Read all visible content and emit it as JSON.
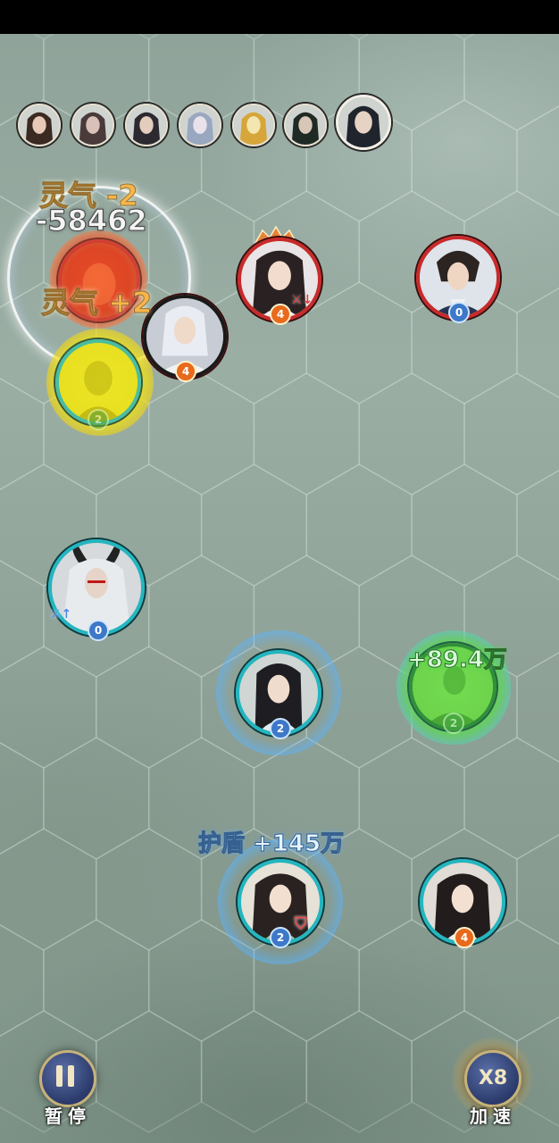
{
  "turn_order": [
    {
      "name": "turn-slot-1",
      "colors": [
        "#3b2a22",
        "#e8c9b8"
      ]
    },
    {
      "name": "turn-slot-2",
      "colors": [
        "#4a3a3a",
        "#d9c0b8"
      ]
    },
    {
      "name": "turn-slot-3",
      "colors": [
        "#2c2a30",
        "#e4cdbd"
      ]
    },
    {
      "name": "turn-slot-4",
      "colors": [
        "#9aa7c0",
        "#e9e2ea"
      ]
    },
    {
      "name": "turn-slot-5",
      "colors": [
        "#d6a63a",
        "#f3e6b0"
      ]
    },
    {
      "name": "turn-slot-6",
      "colors": [
        "#1f2a25",
        "#d8c6b6"
      ]
    },
    {
      "name": "turn-slot-7-current",
      "colors": [
        "#20242c",
        "#e6d3c4"
      ]
    }
  ],
  "units": [
    {
      "id": "enemy-red-burning",
      "side": "enemy",
      "level": "",
      "badge": "orange"
    },
    {
      "id": "enemy-female-top",
      "side": "enemy",
      "level": "4",
      "badge": "orange"
    },
    {
      "id": "enemy-male-top-right",
      "side": "enemy",
      "level": "0",
      "badge": "blue"
    },
    {
      "id": "enemy-white-hair",
      "side": "enemy",
      "level": "4",
      "badge": "orange"
    },
    {
      "id": "ally-yellow-aura",
      "side": "ally",
      "level": "2",
      "badge": "green"
    },
    {
      "id": "ally-horned-demon",
      "side": "ally",
      "level": "0",
      "badge": "blue"
    },
    {
      "id": "ally-male-center",
      "side": "ally",
      "level": "2",
      "badge": "blue"
    },
    {
      "id": "ally-green-healed",
      "side": "ally",
      "level": "2",
      "badge": "green"
    },
    {
      "id": "ally-female-shielded",
      "side": "ally",
      "level": "2",
      "badge": "blue"
    },
    {
      "id": "ally-female-bottom-right",
      "side": "ally",
      "level": "4",
      "badge": "orange"
    }
  ],
  "floating_text": {
    "qi_loss": "灵气 -2",
    "damage": "-58462",
    "qi_gain": "灵气 +2",
    "heal": "+89.4万",
    "shield": "护盾 +145万"
  },
  "controls": {
    "pause_label": "暂停",
    "pause_icon": "pause-icon",
    "speed_value": "X8",
    "speed_label": "加速"
  },
  "colors": {
    "enemy_ring": "#c92a2a",
    "ally_ring": "#23b6c0",
    "button_fill": "#2b3a6a",
    "button_border": "#c7b27a"
  }
}
